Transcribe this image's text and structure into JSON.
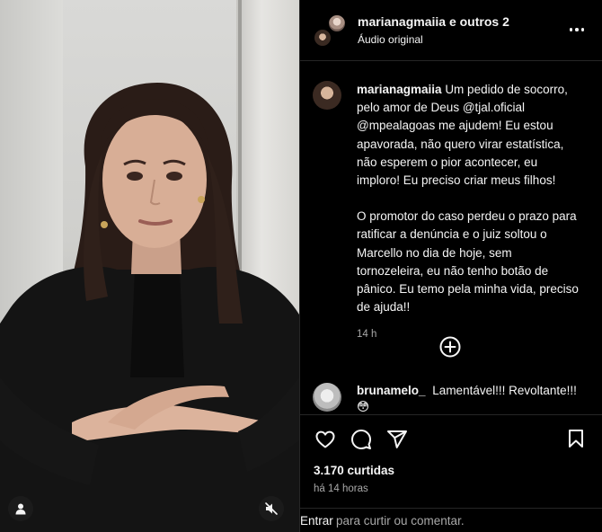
{
  "header": {
    "username": "marianagmaiia",
    "others_label": "e outros 2",
    "audio_label": "Áudio original",
    "more_icon": "more-horizontal-icon"
  },
  "caption": {
    "username": "marianagmaiia",
    "paragraph1": "Um pedido de socorro, pelo amor de Deus @tjal.oficial @mpealagoas me ajudem! Eu estou apavorada, não quero virar estatística, não esperem o pior acontecer, eu imploro! Eu preciso criar meus filhos!",
    "paragraph2": "O promotor do caso perdeu o prazo para ratificar a denúncia e o juiz soltou o Marcello no dia de hoje, sem tornozeleira, eu não tenho botão de pânico. Eu temo pela minha vida, preciso de ajuda!!",
    "time": "14 h"
  },
  "comments": [
    {
      "username": "brunamelo_",
      "text": "Lamentável!!! Revoltante!!! 😳"
    }
  ],
  "actions": {
    "like_icon": "heart-icon",
    "comment_icon": "comment-icon",
    "share_icon": "share-icon",
    "save_icon": "bookmark-icon"
  },
  "likes": "3.170 curtidas",
  "posted": "há 14 horas",
  "comment_input": {
    "enter_label": "Entrar",
    "rest_label": "para curtir ou comentar."
  },
  "colors": {
    "background": "#000000",
    "text": "#f5f5f5",
    "muted": "#a8a8a8",
    "divider": "#262626"
  }
}
